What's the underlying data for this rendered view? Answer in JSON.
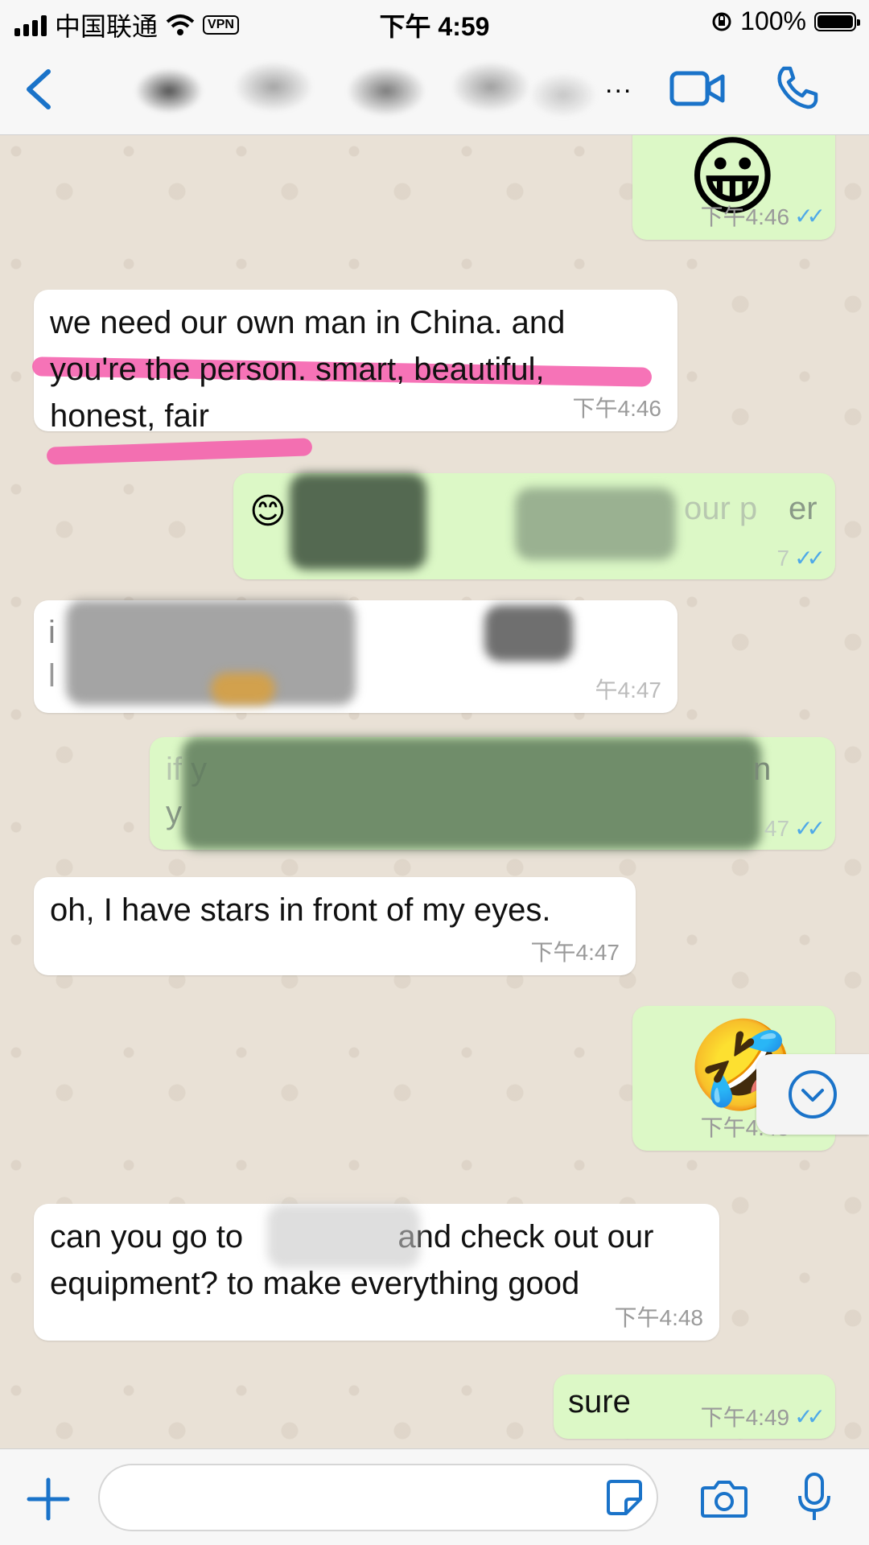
{
  "status_bar": {
    "carrier": "中国联通",
    "vpn": "VPN",
    "time": "下午 4:59",
    "battery": "100%"
  },
  "nav": {
    "more": "...",
    "icons": [
      "chevron-left-icon",
      "video-camera-icon",
      "phone-icon"
    ]
  },
  "messages": [
    {
      "dir": "out",
      "emoji": "😀",
      "time": "下午4:46",
      "ticks": "✓✓"
    },
    {
      "dir": "in",
      "text": "we need our own man in China. and you're the person. smart, beautiful, honest, fair",
      "time": "下午4:46"
    },
    {
      "dir": "out",
      "emoji": "😊",
      "text_fragment": "our p",
      "text_fragment2": "er",
      "time_fragment": "7",
      "ticks": "✓✓"
    },
    {
      "dir": "in",
      "text_fragment": "i",
      "text_fragment2": "l",
      "time_fragment": "午4:47"
    },
    {
      "dir": "out",
      "text_fragment": "if y",
      "text_fragment2": "n",
      "text_fragment3": "y",
      "time_fragment": "47",
      "ticks": "✓✓"
    },
    {
      "dir": "in",
      "text": "oh, I have stars in front of my eyes.",
      "time": "下午4:47"
    },
    {
      "dir": "out",
      "emoji": "🤣",
      "time": "下午4:48",
      "ticks": "✓✓"
    },
    {
      "dir": "in",
      "text_part1": "can you go to ",
      "text_part2": " and check out our",
      "text_line2": "equipment? to make everything good",
      "time": "下午4:48"
    },
    {
      "dir": "out",
      "text": "sure",
      "time": "下午4:49",
      "ticks": "✓✓"
    }
  ],
  "colors": {
    "accent": "#1A73C9",
    "outgoing_bubble": "#DCF8C6",
    "incoming_bubble": "#FFFFFF",
    "read_ticks": "#4FA9E8",
    "highlight": "#F55AAA"
  }
}
